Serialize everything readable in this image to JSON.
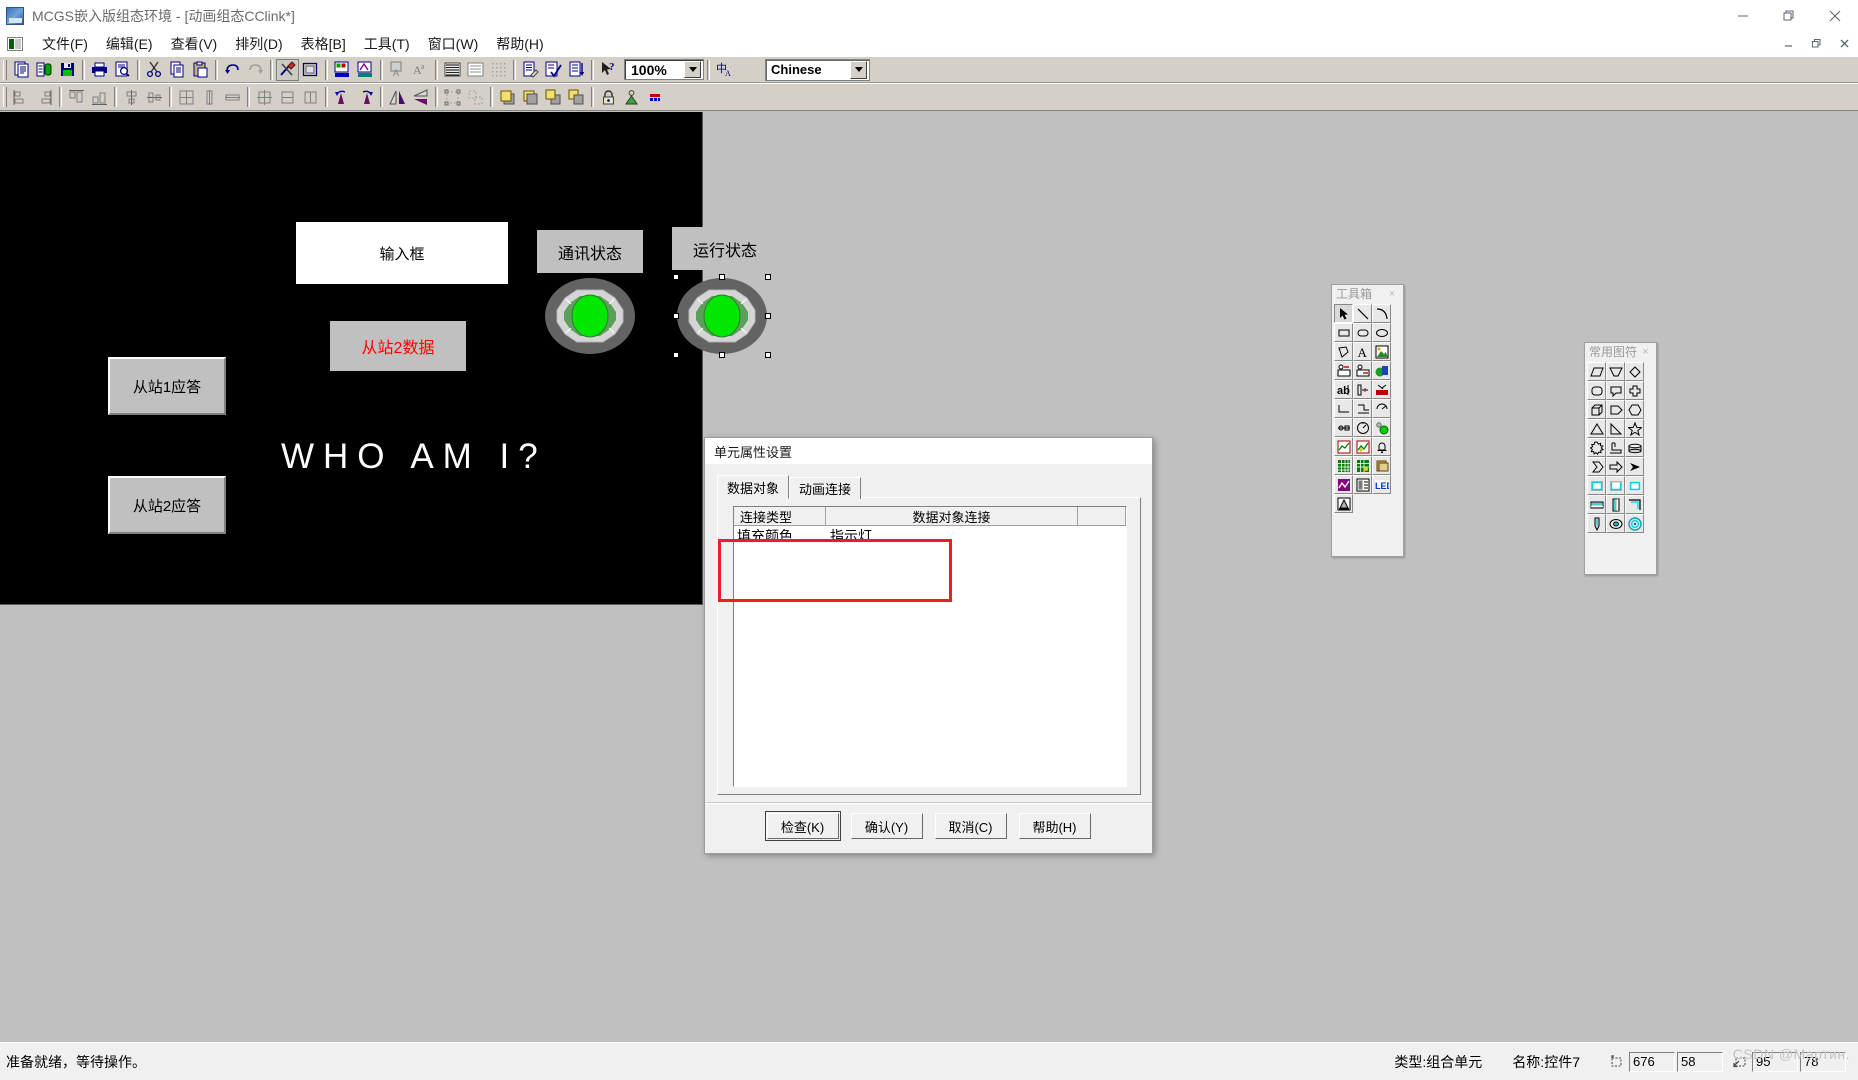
{
  "window": {
    "title": "MCGS嵌入版组态环境 - [动画组态CClink*]",
    "app_icon": "mcgs-logo-icon",
    "controls": {
      "minimize": "–",
      "restore": "❐",
      "close": "✕"
    },
    "mdi_controls": {
      "minimize": "–",
      "restore": "❐",
      "close": "✕"
    }
  },
  "menubar": {
    "doc_icon": "document-icon",
    "items": [
      {
        "label": "文件(F)",
        "name": "menu-file"
      },
      {
        "label": "编辑(E)",
        "name": "menu-edit"
      },
      {
        "label": "查看(V)",
        "name": "menu-view"
      },
      {
        "label": "排列(D)",
        "name": "menu-arrange"
      },
      {
        "label": "表格[B]",
        "name": "menu-table"
      },
      {
        "label": "工具(T)",
        "name": "menu-tools"
      },
      {
        "label": "窗口(W)",
        "name": "menu-window"
      },
      {
        "label": "帮助(H)",
        "name": "menu-help"
      }
    ]
  },
  "toolbar": {
    "zoom": {
      "value": "100%",
      "name": "zoom-combo"
    },
    "language": {
      "value": "Chinese",
      "name": "language-combo"
    },
    "row1_icons": [
      "new-window-icon",
      "window-properties-icon",
      "save-icon",
      "print-icon",
      "print-preview-icon",
      "cut-icon",
      "copy-icon",
      "paste-icon",
      "undo-icon",
      "redo-icon",
      "tools-icon",
      "frame-icon",
      "fill-color-icon",
      "line-color-icon",
      "char-color-icon",
      "font-icon",
      "fill-pattern-icon",
      "line-style-icon",
      "grid-icon",
      "edit-script-icon",
      "check-script-icon",
      "sort-icon",
      "context-help-icon",
      "text-ime-icon"
    ],
    "row2_icons": [
      "align-left-icon",
      "align-right-icon",
      "align-top-icon",
      "align-bottom-icon",
      "center-vertical-icon",
      "center-horizontal-icon",
      "same-size-icon",
      "same-height-icon",
      "same-width-icon",
      "space-even-icon",
      "space-vertical-icon",
      "space-horizontal-icon",
      "rotate-left-icon",
      "rotate-right-icon",
      "flip-horizontal-icon",
      "flip-vertical-icon",
      "group-icon",
      "ungroup-icon",
      "bring-front-icon",
      "send-back-icon",
      "bring-forward-icon",
      "send-backward-icon",
      "lock-icon",
      "unlock-icon",
      "palette-icon"
    ]
  },
  "canvas": {
    "background": "#000000",
    "input_box": {
      "label": "输入框",
      "name": "input-box-element"
    },
    "slave2_data": {
      "label": "从站2数据",
      "color": "#ff0000",
      "name": "slave2-data-label"
    },
    "comm_status": {
      "label": "通讯状态",
      "name": "comm-status-label"
    },
    "run_status": {
      "label": "运行状态",
      "name": "run-status-label"
    },
    "slave1_reply": {
      "label": "从站1应答",
      "name": "slave1-reply-button"
    },
    "slave2_reply": {
      "label": "从站2应答",
      "name": "slave2-reply-button"
    },
    "banner_text": "WHO AM I?",
    "lamp_colors": {
      "outer": "#636363",
      "bezel": "#d0d0d0",
      "bezel_dark": "#9a9a9a",
      "field": "#5aa05a",
      "core": "#00e800"
    },
    "lamps": [
      {
        "name": "comm-status-lamp",
        "selected": false
      },
      {
        "name": "run-status-lamp",
        "selected": true
      }
    ]
  },
  "toolbox_palette": {
    "title": "工具箱",
    "close_label": "×",
    "items": [
      "select-arrow-icon",
      "line-icon",
      "arc-icon",
      "rectangle-icon",
      "rounded-rect-icon",
      "ellipse-icon",
      "polygon-icon",
      "text-icon",
      "picture-icon",
      "input-display-icon",
      "output-display-icon",
      "button-icon",
      "label-icon",
      "slider-icon",
      "scrollbar-icon",
      "flow-block-icon",
      "pipe-icon",
      "dial-icon",
      "valve-icon",
      "meter-icon",
      "indicator-lamp-icon",
      "realtime-chart-icon",
      "history-chart-icon",
      "alarm-bell-icon",
      "realtime-table-icon",
      "history-table-icon",
      "report-icon",
      "curve-icon",
      "form-icon",
      "led-icon",
      "animation-icon"
    ]
  },
  "symbols_palette": {
    "title": "常用图符",
    "close_label": "×",
    "items": [
      "parallelogram-icon",
      "trapezoid-icon",
      "diamond-icon",
      "rounded-box-icon",
      "speech-bubble-icon",
      "cross-box-icon",
      "cube-icon",
      "flag-arrow-icon",
      "hexagon-icon",
      "triangle-icon",
      "right-triangle-icon",
      "star-icon",
      "sun-burst-icon",
      "elbow-icon",
      "cylinder-icon",
      "arrow-outline-icon",
      "thick-arrow-icon",
      "solid-arrow-icon",
      "frame-cyan-icon",
      "frame-open-icon",
      "frame-thin-icon",
      "bar-3d-icon",
      "column-3d-icon",
      "corner-3d-icon",
      "pointer-icon",
      "dot-target-icon",
      "ring-target-icon"
    ]
  },
  "dialog": {
    "title": "单元属性设置",
    "tabs": [
      {
        "label": "数据对象",
        "name": "tab-data-object",
        "active": true
      },
      {
        "label": "动画连接",
        "name": "tab-animation-link",
        "active": false
      }
    ],
    "list": {
      "columns": [
        "连接类型",
        "数据对象连接",
        ""
      ],
      "rows": [
        {
          "连接类型": "填充颜色",
          "数据对象连接": "指示灯"
        }
      ]
    },
    "highlight_color": "#ee1c25",
    "buttons": [
      {
        "label": "检查(K)",
        "name": "check-button",
        "default": true
      },
      {
        "label": "确认(Y)",
        "name": "confirm-button",
        "default": false
      },
      {
        "label": "取消(C)",
        "name": "cancel-button",
        "default": false
      },
      {
        "label": "帮助(H)",
        "name": "help-button",
        "default": false
      }
    ]
  },
  "statusbar": {
    "message": "准备就绪，等待操作。",
    "type_label": "类型:组合单元",
    "name_label": "名称:控件7",
    "position_icon": "position-icon",
    "size_icon": "size-icon",
    "pos_x": "676",
    "pos_y": "58",
    "size_w": "95",
    "size_h": "78",
    "watermark": "CSDN @Мартин."
  }
}
